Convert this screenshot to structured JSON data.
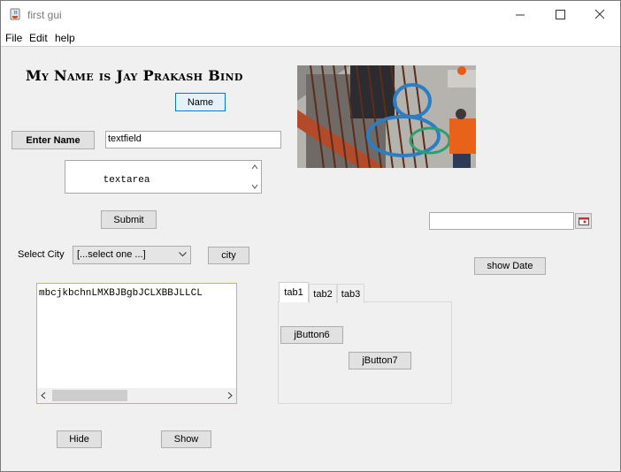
{
  "window": {
    "title": "first gui"
  },
  "menu": {
    "items": [
      "File",
      "Edit",
      "help"
    ]
  },
  "header": {
    "heading": "My Name is Jay Prakash Bind",
    "name_button": "Name"
  },
  "form": {
    "enter_name_button": "Enter Name",
    "textfield_value": "textfield",
    "textarea_value": "textarea",
    "submit_button": "Submit",
    "select_city_label": "Select City",
    "city_combo_value": "[...select one ...]",
    "city_button": "city",
    "long_text_value": "mbcjkbchnLMXBJBgbJCLXBBJLLCL",
    "hide_button": "Hide",
    "show_button": "Show"
  },
  "date": {
    "value": "",
    "show_date_button": "show Date",
    "picker_icon": "calendar-icon"
  },
  "tabs": {
    "items": [
      "tab1",
      "tab2",
      "tab3"
    ],
    "active": "tab1",
    "button6": "jButton6",
    "button7": "jButton7"
  },
  "image": {
    "description_icon": "construction-photo"
  },
  "colors": {
    "focus_border": "#0078d7",
    "panel_bg": "#f0f0f0",
    "scroll_border": "#c8c800"
  }
}
